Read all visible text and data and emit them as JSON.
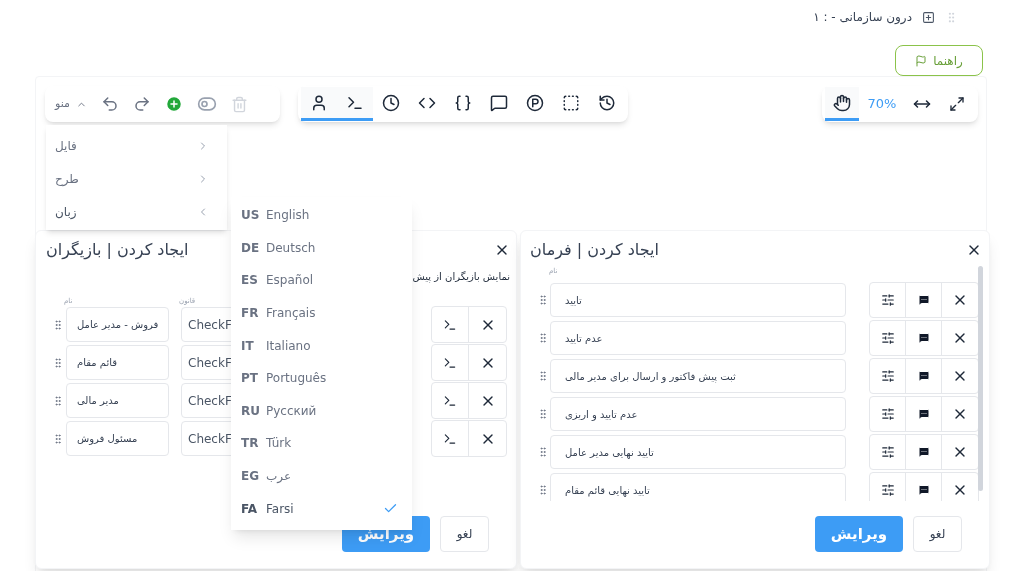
{
  "header": {
    "title": "۱ : - درون سازمانی"
  },
  "guide_button": {
    "label": "راهنما"
  },
  "toolbar_left": {
    "menu_label": "منو",
    "menu_expanded": true,
    "delete_disabled": true
  },
  "toolbar_tools": [
    {
      "selected": true
    },
    {
      "selected": true
    },
    {
      "selected": false
    },
    {
      "selected": false
    },
    {
      "selected": false
    },
    {
      "selected": false
    },
    {
      "selected": false
    },
    {
      "selected": false
    },
    {
      "selected": false
    }
  ],
  "zoom_toolbar": {
    "hand_selected": true,
    "zoom": "70%"
  },
  "menu": [
    {
      "label": "فایل",
      "expanded": false
    },
    {
      "label": "طرح",
      "expanded": false
    },
    {
      "label": "زبان",
      "expanded": true
    }
  ],
  "languages": [
    {
      "code": "US",
      "name": "English",
      "selected": false
    },
    {
      "code": "DE",
      "name": "Deutsch",
      "selected": false
    },
    {
      "code": "ES",
      "name": "Español",
      "selected": false
    },
    {
      "code": "FR",
      "name": "Français",
      "selected": false
    },
    {
      "code": "IT",
      "name": "Italiano",
      "selected": false
    },
    {
      "code": "PT",
      "name": "Português",
      "selected": false
    },
    {
      "code": "RU",
      "name": "Русский",
      "selected": false
    },
    {
      "code": "TR",
      "name": "Türk",
      "selected": false
    },
    {
      "code": "EG",
      "name": "عرب",
      "selected": false
    },
    {
      "code": "FA",
      "name": "Farsi",
      "selected": true
    }
  ],
  "actors_dialog": {
    "title": "ایجاد کردن | بازیگران",
    "option_text": "نمایش بازیگران از پیش",
    "columns": [
      "قانون",
      "نام"
    ],
    "rows": [
      {
        "name": "فروش - مدیر عامل",
        "rule": "CheckF"
      },
      {
        "name": "قائم مقام",
        "rule": "CheckF"
      },
      {
        "name": "مدیر مالی",
        "rule": "CheckF"
      },
      {
        "name": "مسئول فروش",
        "rule": "CheckF"
      }
    ],
    "primary_button": "ویرایش",
    "cancel_button": "لغو"
  },
  "commands_dialog": {
    "title": "ایجاد کردن | فرمان",
    "column": "نام",
    "rows": [
      {
        "name": "تایید"
      },
      {
        "name": "عدم تایید"
      },
      {
        "name": "ثبت پیش فاکتور و ارسال برای مدیر مالی"
      },
      {
        "name": "عدم تایید و اریزی"
      },
      {
        "name": "تایید نهایی مدیر عامل"
      },
      {
        "name": "تایید نهایی قائم مقام"
      }
    ],
    "primary_button": "ویرایش",
    "cancel_button": "لغو"
  }
}
